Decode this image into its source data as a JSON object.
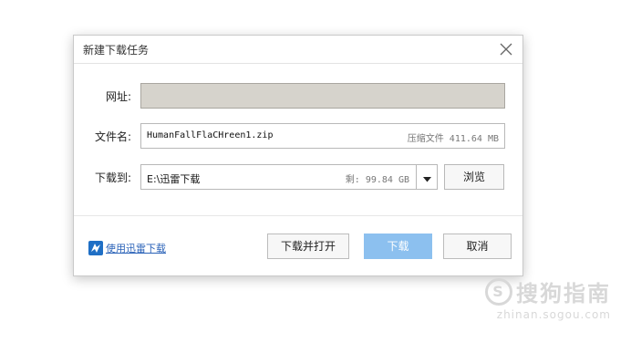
{
  "dialog": {
    "title": "新建下载任务"
  },
  "form": {
    "url_label": "网址:",
    "url_value": "",
    "filename_label": "文件名:",
    "filename_value": "HumanFallFlaCHreen1.zip",
    "file_info": "压缩文件 411.64 MB",
    "saveto_label": "下载到:",
    "saveto_value": "E:\\迅雷下载",
    "free_space": "剩: 99.84 GB",
    "browse_label": "浏览"
  },
  "footer": {
    "xunlei_link": "使用迅雷下载",
    "download_open_label": "下载并打开",
    "download_label": "下载",
    "cancel_label": "取消"
  },
  "watermark": {
    "brand": "搜狗指南",
    "site": "zhinan.sogou.com"
  },
  "colors": {
    "accent": "#8cc0ef",
    "link": "#2a62b8",
    "url_field_bg": "#d6d3cc"
  },
  "icons": [
    "close-icon",
    "chevron-down-icon",
    "xunlei-icon",
    "sogou-logo-icon"
  ]
}
